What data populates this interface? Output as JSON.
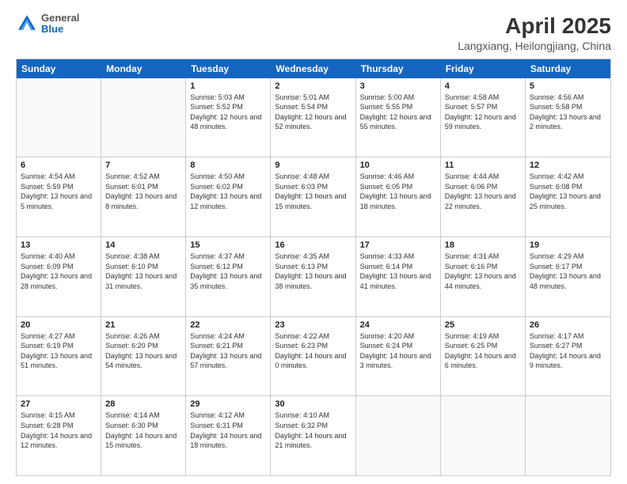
{
  "header": {
    "title": "April 2025",
    "subtitle": "Langxiang, Heilongjiang, China",
    "logo_general": "General",
    "logo_blue": "Blue"
  },
  "days_of_week": [
    "Sunday",
    "Monday",
    "Tuesday",
    "Wednesday",
    "Thursday",
    "Friday",
    "Saturday"
  ],
  "weeks": [
    [
      {
        "day": "",
        "empty": true
      },
      {
        "day": "",
        "empty": true
      },
      {
        "day": "1",
        "sunrise": "Sunrise: 5:03 AM",
        "sunset": "Sunset: 5:52 PM",
        "daylight": "Daylight: 12 hours and 48 minutes."
      },
      {
        "day": "2",
        "sunrise": "Sunrise: 5:01 AM",
        "sunset": "Sunset: 5:54 PM",
        "daylight": "Daylight: 12 hours and 52 minutes."
      },
      {
        "day": "3",
        "sunrise": "Sunrise: 5:00 AM",
        "sunset": "Sunset: 5:55 PM",
        "daylight": "Daylight: 12 hours and 55 minutes."
      },
      {
        "day": "4",
        "sunrise": "Sunrise: 4:58 AM",
        "sunset": "Sunset: 5:57 PM",
        "daylight": "Daylight: 12 hours and 59 minutes."
      },
      {
        "day": "5",
        "sunrise": "Sunrise: 4:56 AM",
        "sunset": "Sunset: 5:58 PM",
        "daylight": "Daylight: 13 hours and 2 minutes."
      }
    ],
    [
      {
        "day": "6",
        "sunrise": "Sunrise: 4:54 AM",
        "sunset": "Sunset: 5:59 PM",
        "daylight": "Daylight: 13 hours and 5 minutes."
      },
      {
        "day": "7",
        "sunrise": "Sunrise: 4:52 AM",
        "sunset": "Sunset: 6:01 PM",
        "daylight": "Daylight: 13 hours and 8 minutes."
      },
      {
        "day": "8",
        "sunrise": "Sunrise: 4:50 AM",
        "sunset": "Sunset: 6:02 PM",
        "daylight": "Daylight: 13 hours and 12 minutes."
      },
      {
        "day": "9",
        "sunrise": "Sunrise: 4:48 AM",
        "sunset": "Sunset: 6:03 PM",
        "daylight": "Daylight: 13 hours and 15 minutes."
      },
      {
        "day": "10",
        "sunrise": "Sunrise: 4:46 AM",
        "sunset": "Sunset: 6:05 PM",
        "daylight": "Daylight: 13 hours and 18 minutes."
      },
      {
        "day": "11",
        "sunrise": "Sunrise: 4:44 AM",
        "sunset": "Sunset: 6:06 PM",
        "daylight": "Daylight: 13 hours and 22 minutes."
      },
      {
        "day": "12",
        "sunrise": "Sunrise: 4:42 AM",
        "sunset": "Sunset: 6:08 PM",
        "daylight": "Daylight: 13 hours and 25 minutes."
      }
    ],
    [
      {
        "day": "13",
        "sunrise": "Sunrise: 4:40 AM",
        "sunset": "Sunset: 6:09 PM",
        "daylight": "Daylight: 13 hours and 28 minutes."
      },
      {
        "day": "14",
        "sunrise": "Sunrise: 4:38 AM",
        "sunset": "Sunset: 6:10 PM",
        "daylight": "Daylight: 13 hours and 31 minutes."
      },
      {
        "day": "15",
        "sunrise": "Sunrise: 4:37 AM",
        "sunset": "Sunset: 6:12 PM",
        "daylight": "Daylight: 13 hours and 35 minutes."
      },
      {
        "day": "16",
        "sunrise": "Sunrise: 4:35 AM",
        "sunset": "Sunset: 6:13 PM",
        "daylight": "Daylight: 13 hours and 38 minutes."
      },
      {
        "day": "17",
        "sunrise": "Sunrise: 4:33 AM",
        "sunset": "Sunset: 6:14 PM",
        "daylight": "Daylight: 13 hours and 41 minutes."
      },
      {
        "day": "18",
        "sunrise": "Sunrise: 4:31 AM",
        "sunset": "Sunset: 6:16 PM",
        "daylight": "Daylight: 13 hours and 44 minutes."
      },
      {
        "day": "19",
        "sunrise": "Sunrise: 4:29 AM",
        "sunset": "Sunset: 6:17 PM",
        "daylight": "Daylight: 13 hours and 48 minutes."
      }
    ],
    [
      {
        "day": "20",
        "sunrise": "Sunrise: 4:27 AM",
        "sunset": "Sunset: 6:19 PM",
        "daylight": "Daylight: 13 hours and 51 minutes."
      },
      {
        "day": "21",
        "sunrise": "Sunrise: 4:26 AM",
        "sunset": "Sunset: 6:20 PM",
        "daylight": "Daylight: 13 hours and 54 minutes."
      },
      {
        "day": "22",
        "sunrise": "Sunrise: 4:24 AM",
        "sunset": "Sunset: 6:21 PM",
        "daylight": "Daylight: 13 hours and 57 minutes."
      },
      {
        "day": "23",
        "sunrise": "Sunrise: 4:22 AM",
        "sunset": "Sunset: 6:23 PM",
        "daylight": "Daylight: 14 hours and 0 minutes."
      },
      {
        "day": "24",
        "sunrise": "Sunrise: 4:20 AM",
        "sunset": "Sunset: 6:24 PM",
        "daylight": "Daylight: 14 hours and 3 minutes."
      },
      {
        "day": "25",
        "sunrise": "Sunrise: 4:19 AM",
        "sunset": "Sunset: 6:25 PM",
        "daylight": "Daylight: 14 hours and 6 minutes."
      },
      {
        "day": "26",
        "sunrise": "Sunrise: 4:17 AM",
        "sunset": "Sunset: 6:27 PM",
        "daylight": "Daylight: 14 hours and 9 minutes."
      }
    ],
    [
      {
        "day": "27",
        "sunrise": "Sunrise: 4:15 AM",
        "sunset": "Sunset: 6:28 PM",
        "daylight": "Daylight: 14 hours and 12 minutes."
      },
      {
        "day": "28",
        "sunrise": "Sunrise: 4:14 AM",
        "sunset": "Sunset: 6:30 PM",
        "daylight": "Daylight: 14 hours and 15 minutes."
      },
      {
        "day": "29",
        "sunrise": "Sunrise: 4:12 AM",
        "sunset": "Sunset: 6:31 PM",
        "daylight": "Daylight: 14 hours and 18 minutes."
      },
      {
        "day": "30",
        "sunrise": "Sunrise: 4:10 AM",
        "sunset": "Sunset: 6:32 PM",
        "daylight": "Daylight: 14 hours and 21 minutes."
      },
      {
        "day": "",
        "empty": true
      },
      {
        "day": "",
        "empty": true
      },
      {
        "day": "",
        "empty": true
      }
    ]
  ]
}
